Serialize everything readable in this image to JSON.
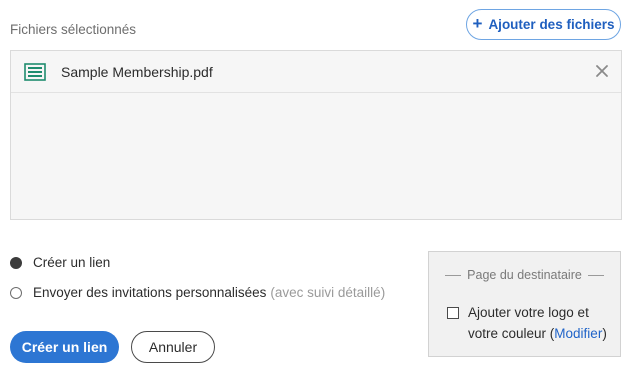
{
  "files": {
    "section_label": "Fichiers sélectionnés",
    "add_button_label": "Ajouter des fichiers",
    "items": [
      {
        "name": "Sample Membership.pdf"
      }
    ]
  },
  "distribution": {
    "options": [
      {
        "label": "Créer un lien",
        "selected": true
      },
      {
        "label": "Envoyer des invitations personnalisées",
        "note": "(avec suivi détaillé)",
        "selected": false
      }
    ]
  },
  "recipient_page": {
    "title": "Page du destinataire",
    "logo_option": {
      "label": "Ajouter votre logo et votre couleur",
      "link_label": "Modifier",
      "checked": false
    }
  },
  "actions": {
    "primary_label": "Créer un lien",
    "secondary_label": "Annuler"
  },
  "colors": {
    "accent": "#2d76d3",
    "link": "#1f63c8",
    "file_icon": "#1e8c6e"
  }
}
